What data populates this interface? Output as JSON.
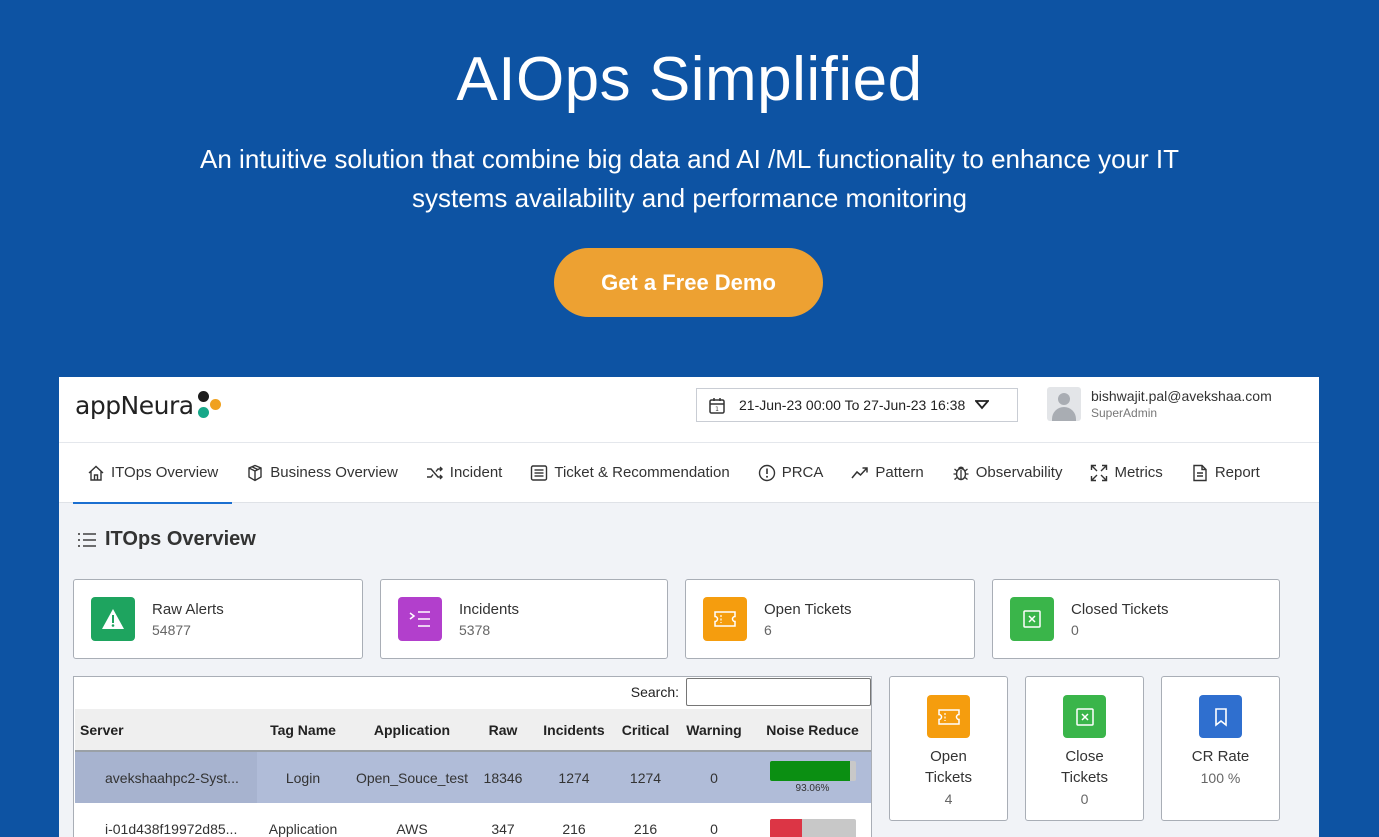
{
  "hero": {
    "title": "AIOps Simplified",
    "subtitle": "An intuitive solution that combine big data and AI /ML functionality to enhance your IT systems availability and performance monitoring",
    "cta_label": "Get a Free Demo"
  },
  "app": {
    "logo_text": "appNeura",
    "date_range": "21-Jun-23 00:00 To 27-Jun-23 16:38",
    "user": {
      "email": "bishwajit.pal@avekshaa.com",
      "role": "SuperAdmin"
    },
    "nav": [
      {
        "label": "ITOps Overview",
        "icon": "home-icon",
        "active": true
      },
      {
        "label": "Business Overview",
        "icon": "box-icon"
      },
      {
        "label": "Incident",
        "icon": "shuffle-icon"
      },
      {
        "label": "Ticket & Recommendation",
        "icon": "list-icon"
      },
      {
        "label": "PRCA",
        "icon": "alert-circle-icon"
      },
      {
        "label": "Pattern",
        "icon": "trend-icon"
      },
      {
        "label": "Observability",
        "icon": "bug-icon"
      },
      {
        "label": "Metrics",
        "icon": "expand-icon"
      },
      {
        "label": "Report",
        "icon": "file-icon"
      }
    ],
    "section_title": "ITOps Overview",
    "stats": [
      {
        "label": "Raw Alerts",
        "value": "54877",
        "color": "#1ea45f",
        "icon": "warning-icon"
      },
      {
        "label": "Incidents",
        "value": "5378",
        "color": "#b23fcc",
        "icon": "list-arrow-icon"
      },
      {
        "label": "Open Tickets",
        "value": "6",
        "color": "#f59d0e",
        "icon": "ticket-icon"
      },
      {
        "label": "Closed Tickets",
        "value": "0",
        "color": "#3ab54a",
        "icon": "close-box-icon"
      }
    ],
    "table": {
      "search_label": "Search:",
      "columns": [
        "Server",
        "Tag Name",
        "Application",
        "Raw",
        "Incidents",
        "Critical",
        "Warning",
        "Noise Reduce"
      ],
      "rows": [
        {
          "server": "avekshaahpc2-Syst...",
          "tag": "Login",
          "application": "Open_Souce_test",
          "raw": "18346",
          "incidents": "1274",
          "critical": "1274",
          "warning": "0",
          "noise_pct": "93.06%",
          "noise": 0.9306,
          "noise_color": "#0b8f12"
        },
        {
          "server": "i-01d438f19972d85...",
          "tag": "Application",
          "application": "AWS",
          "raw": "347",
          "incidents": "216",
          "critical": "216",
          "warning": "0",
          "noise_pct": "",
          "noise": 0.38,
          "noise_color": "#dc3545"
        }
      ]
    },
    "mini_cards": [
      {
        "label1": "Open",
        "label2": "Tickets",
        "value": "4",
        "color": "#f59d0e",
        "icon": "ticket-icon"
      },
      {
        "label1": "Close",
        "label2": "Tickets",
        "value": "0",
        "color": "#3ab54a",
        "icon": "close-box-icon"
      },
      {
        "label1": "CR Rate",
        "label2": "",
        "value": "100 %",
        "color": "#2f6fcf",
        "icon": "bookmark-icon"
      }
    ]
  }
}
